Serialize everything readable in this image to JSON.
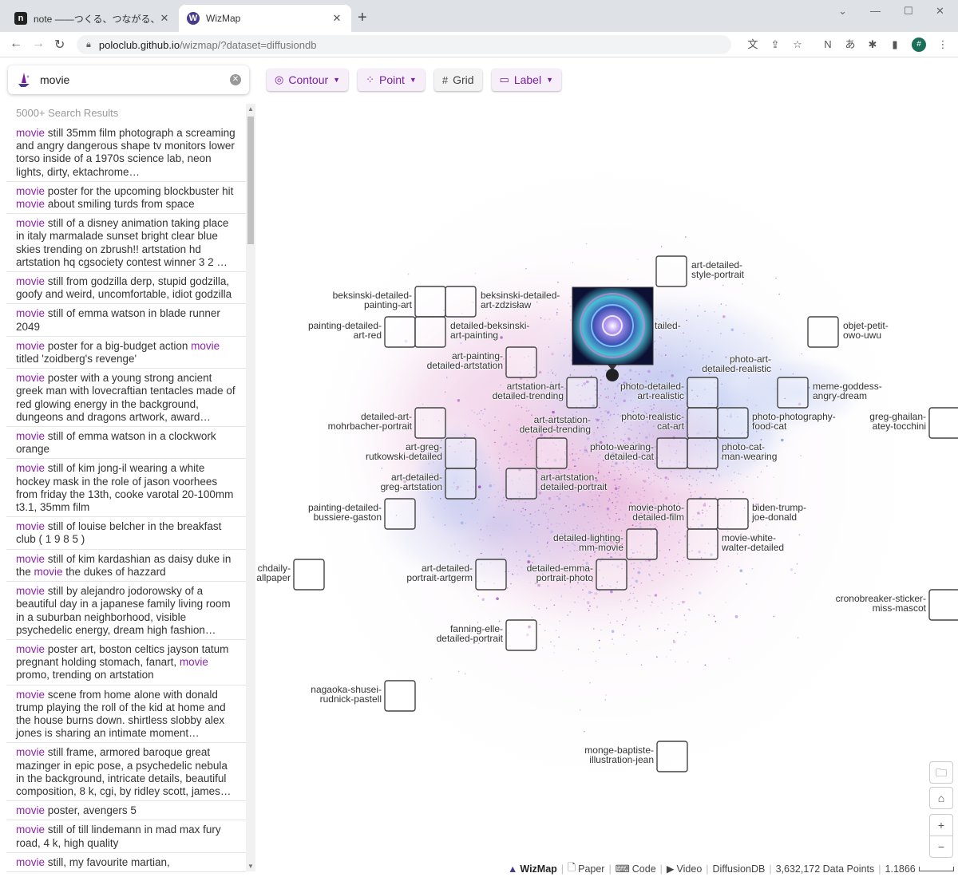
{
  "browser": {
    "tabs": [
      {
        "title": "note ——つくる、つながる、とどける。",
        "favicon": "n"
      },
      {
        "title": "WizMap",
        "favicon": "W"
      }
    ],
    "url_host": "poloclub.github.io",
    "url_path": "/wizmap/?dataset=diffusiondb"
  },
  "search": {
    "query": "movie",
    "result_count": "5000+ Search Results",
    "highlight": "movie",
    "results": [
      "movie still 35mm film photograph a screaming and angry dangerous shape tv monitors lower torso inside of a 1970s science lab, neon lights, dirty, ektachrome…",
      "movie poster for the upcoming blockbuster hit movie about smiling turds from space",
      "movie still of a disney animation taking place in italy marmalade sunset bright clear blue skies trending on zbrush!! artstation hd artstation hq cgsociety contest winner 3 2 …",
      "movie still from godzilla derp, stupid godzilla, goofy and weird, uncomfortable, idiot godzilla",
      "movie still of emma watson in blade runner 2049",
      "movie poster for a big-budget action movie titled 'zoidberg's revenge'",
      "movie poster with a young strong ancient greek man with lovecraftian tentacles made of red glowing energy in the background, dungeons and dragons artwork, award…",
      "movie still of emma watson in a clockwork orange",
      "movie still of kim jong-il wearing a white hockey mask in the role of jason voorhees from friday the 13th, cooke varotal 20-100mm t3.1, 35mm film",
      "movie still of louise belcher in the breakfast club ( 1 9 8 5 )",
      "movie still of kim kardashian as daisy duke in the movie the dukes of hazzard",
      "movie still by alejandro jodorowsky of a beautiful day in a japanese family living room in a suburban neighborhood, visible psychedelic energy, dream high fashion…",
      "movie poster art, boston celtics jayson tatum pregnant holding stomach, fanart, movie promo, trending on artstation",
      "movie scene from home alone with donald trump playing the roll of the kid at home and the house burns down. shirtless slobby alex jones is sharing an intimate moment…",
      "movie still frame, armored baroque great mazinger in epic pose, a psychedelic nebula in the background, intricate details, beautiful composition, 8 k, cgi, by ridley scott, james…",
      "movie poster, avengers 5",
      "movie still of till lindemann in mad max fury road, 4 k, high quality",
      "movie still, my favourite martian,"
    ]
  },
  "controls": {
    "contour": "Contour",
    "point": "Point",
    "grid": "Grid",
    "label": "Label"
  },
  "map_labels": [
    {
      "id": "art-detailed-style-portrait",
      "lines": [
        "art-detailed-",
        "style-portrait"
      ],
      "side": "right"
    },
    {
      "id": "beksinski-detailed-painting-art",
      "lines": [
        "beksinski-detailed-",
        "painting-art"
      ],
      "side": "left"
    },
    {
      "id": "beksinski-detailed-art-zdzislaw",
      "lines": [
        "beksinski-detailed-",
        "art-zdzisław"
      ],
      "side": "right"
    },
    {
      "id": "painting-detailed-art-red",
      "lines": [
        "painting-detailed-",
        "art-red"
      ],
      "side": "left"
    },
    {
      "id": "detailed-beksinski-art-painting",
      "lines": [
        "detailed-beksinski-",
        "art-painting"
      ],
      "side": "right"
    },
    {
      "id": "tailed",
      "lines": [
        "tailed-"
      ],
      "side": "right"
    },
    {
      "id": "objet-petit-owo-uwu",
      "lines": [
        "objet-petit-",
        "owo-uwu"
      ],
      "side": "right"
    },
    {
      "id": "art-painting-detailed-artstation",
      "lines": [
        "art-painting-",
        "detailed-artstation"
      ],
      "side": "left"
    },
    {
      "id": "photo-art-detailed-realistic",
      "lines": [
        "photo-art-",
        "detailed-realistic"
      ],
      "side": "left"
    },
    {
      "id": "artstation-art-detailed-trending",
      "lines": [
        "artstation-art-",
        "detailed-trending"
      ],
      "side": "left"
    },
    {
      "id": "photo-detailed-art-realistic",
      "lines": [
        "photo-detailed-",
        "art-realistic"
      ],
      "side": "left"
    },
    {
      "id": "meme-goddess-angry-dream",
      "lines": [
        "meme-goddess-",
        "angry-dream"
      ],
      "side": "right"
    },
    {
      "id": "detailed-art-mohrbacher-portrait",
      "lines": [
        "detailed-art-",
        "mohrbacher-portrait"
      ],
      "side": "left"
    },
    {
      "id": "art-artstation-detailed-trending",
      "lines": [
        "art-artstation-",
        "detailed-trending"
      ],
      "side": "left"
    },
    {
      "id": "photo-realistic-cat-art",
      "lines": [
        "photo-realistic-",
        "cat-art"
      ],
      "side": "left"
    },
    {
      "id": "photo-photography-food-cat",
      "lines": [
        "photo-photography-",
        "food-cat"
      ],
      "side": "right"
    },
    {
      "id": "greg-ghailan-atey-tocchini",
      "lines": [
        "greg-ghailan-",
        "atey-tocchini"
      ],
      "side": "left"
    },
    {
      "id": "art-greg-rutkowski-detailed",
      "lines": [
        "art-greg-",
        "rutkowski-detailed"
      ],
      "side": "left"
    },
    {
      "id": "photo-wearing-detailed-cat",
      "lines": [
        "photo-wearing-",
        "detailed-cat"
      ],
      "side": "left"
    },
    {
      "id": "photo-cat-man-wearing",
      "lines": [
        "photo-cat-",
        "man-wearing"
      ],
      "side": "right"
    },
    {
      "id": "art-detailed-greg-artstation",
      "lines": [
        "art-detailed-",
        "greg-artstation"
      ],
      "side": "left"
    },
    {
      "id": "art-artstation-detailed-portrait",
      "lines": [
        "art-artstation-",
        "detailed-portrait"
      ],
      "side": "right"
    },
    {
      "id": "painting-detailed-bussiere-gaston",
      "lines": [
        "painting-detailed-",
        "bussiere-gaston"
      ],
      "side": "left"
    },
    {
      "id": "movie-photo-detailed-film",
      "lines": [
        "movie-photo-",
        "detailed-film"
      ],
      "side": "left"
    },
    {
      "id": "biden-trump-joe-donald",
      "lines": [
        "biden-trump-",
        "joe-donald"
      ],
      "side": "right"
    },
    {
      "id": "detailed-lighting-mm-movie",
      "lines": [
        "detailed-lighting-",
        "mm-movie"
      ],
      "side": "left"
    },
    {
      "id": "movie-white-walter-detailed",
      "lines": [
        "movie-white-",
        "walter-detailed"
      ],
      "side": "right"
    },
    {
      "id": "chdaily-allpaper",
      "lines": [
        "chdaily-",
        "allpaper"
      ],
      "side": "left"
    },
    {
      "id": "art-detailed-portrait-artgerm",
      "lines": [
        "art-detailed-",
        "portrait-artgerm"
      ],
      "side": "left"
    },
    {
      "id": "detailed-emma-portrait-photo",
      "lines": [
        "detailed-emma-",
        "portrait-photo"
      ],
      "side": "left"
    },
    {
      "id": "cronobreaker-sticker-miss-mascot",
      "lines": [
        "cronobreaker-sticker-",
        "miss-mascot"
      ],
      "side": "left"
    },
    {
      "id": "fanning-elle-detailed-portrait",
      "lines": [
        "fanning-elle-",
        "detailed-portrait"
      ],
      "side": "left"
    },
    {
      "id": "nagaoka-shusei-rudnick-pastell",
      "lines": [
        "nagaoka-shusei-",
        "rudnick-pastell"
      ],
      "side": "left"
    },
    {
      "id": "monge-baptiste-illustration-jean",
      "lines": [
        "monge-baptiste-",
        "illustration-jean"
      ],
      "side": "left"
    }
  ],
  "side_buttons": [
    "folder-icon",
    "home-icon",
    "zoom-in-icon",
    "zoom-out-icon"
  ],
  "footer": {
    "brand": "WizMap",
    "paper": "Paper",
    "code": "Code",
    "video": "Video",
    "dataset": "DiffusionDB",
    "points": "3,632,172 Data Points",
    "zoom": "1.1866"
  },
  "colors": {
    "accent": "#8e24aa",
    "contour_pink": "#e8b8dc",
    "contour_blue": "#b8c6ee"
  }
}
